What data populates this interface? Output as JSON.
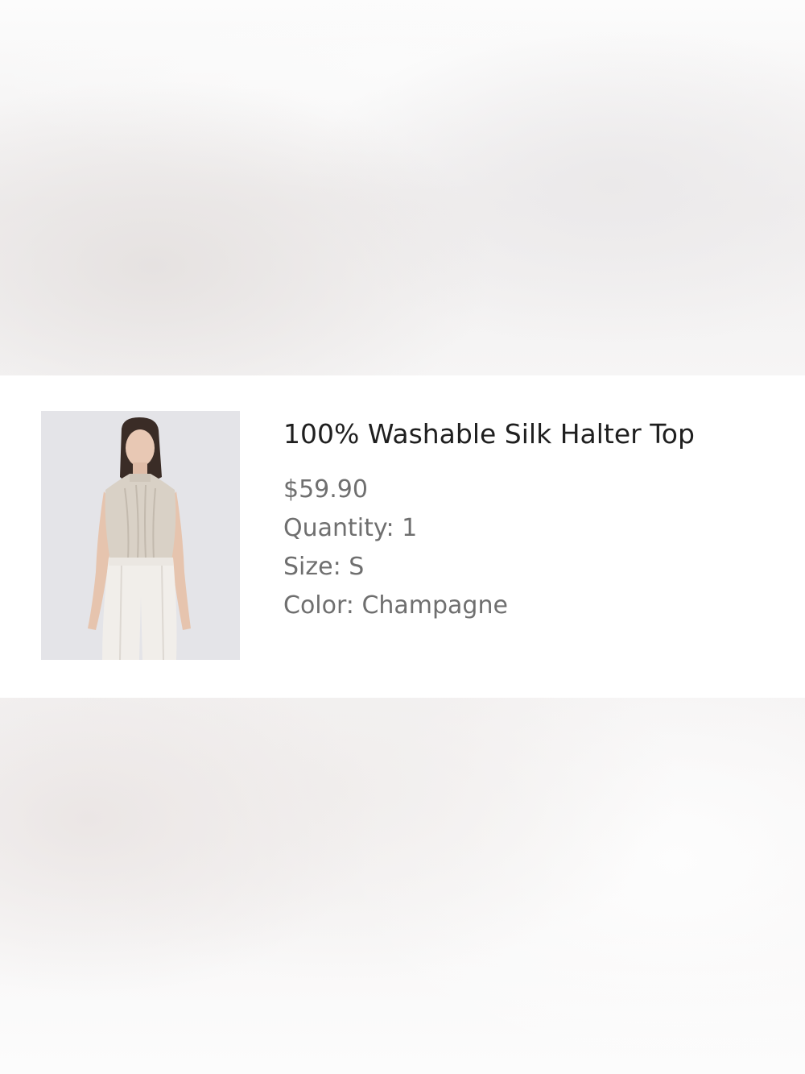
{
  "product": {
    "title": "100% Washable Silk Halter Top",
    "price": "$59.90",
    "quantity": "Quantity: 1",
    "size": "Size: S",
    "color": "Color: Champagne",
    "image_subject": "model-wearing-halter-top"
  },
  "colors": {
    "card_background": "#ffffff",
    "title_text": "#1f1f1f",
    "detail_text": "#6f6f6f",
    "thumbnail_background": "#e4e4e8"
  }
}
